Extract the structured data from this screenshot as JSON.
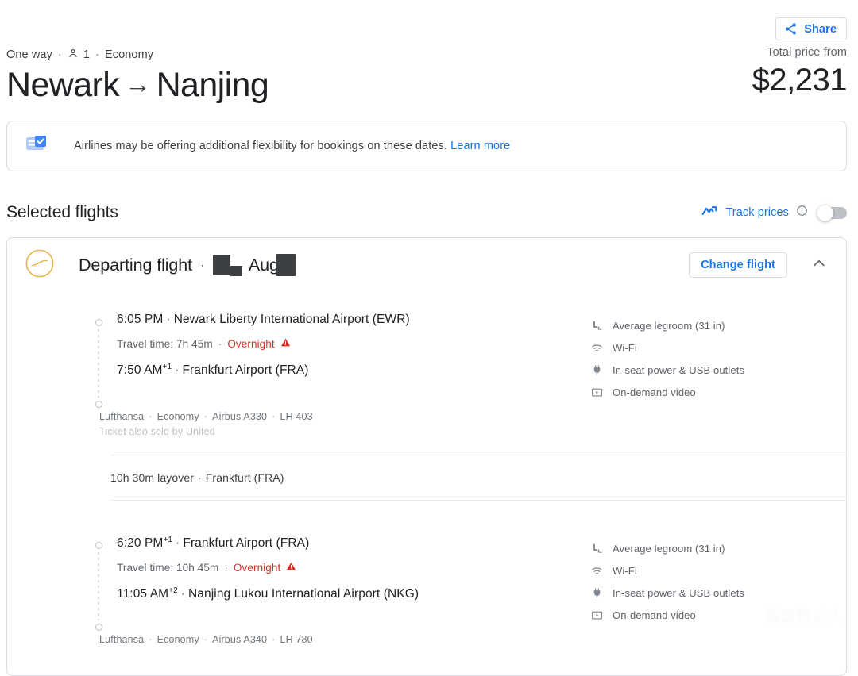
{
  "topbar": {
    "share_label": "Share",
    "share_icon": "share-icon"
  },
  "header": {
    "trip_type": "One way",
    "passengers": "1",
    "cabin": "Economy",
    "separator": "·",
    "origin": "Newark",
    "arrow": "→",
    "destination": "Nanjing",
    "price_label": "Total price from",
    "price_value": "$2,231"
  },
  "banner": {
    "icon": "ticket-check-icon",
    "text": "Airlines may be offering additional flexibility for bookings on these dates.",
    "link_label": "Learn more"
  },
  "selected": {
    "title": "Selected flights",
    "track_icon": "trending-line-icon",
    "track_label": "Track prices",
    "info_icon": "info-icon",
    "toggle_state": "off"
  },
  "flight_card": {
    "airline_logo": "lufthansa-crane-logo",
    "title": "Departing flight",
    "separator": "·",
    "date_month": "Aug",
    "date_redacted": true,
    "change_flight_label": "Change flight",
    "collapse_icon": "chevron-up-icon",
    "segments": [
      {
        "depart_time": "6:05 PM",
        "depart_day_offset": "",
        "depart_airport": "Newark Liberty International Airport (EWR)",
        "travel_time": "Travel time: 7h 45m",
        "overnight_label": "Overnight",
        "overnight_icon": "warning-triangle-icon",
        "arrive_time": "7:50 AM",
        "arrive_day_offset": "+1",
        "arrive_airport": "Frankfurt Airport (FRA)",
        "airline": "Lufthansa",
        "cabin": "Economy",
        "aircraft": "Airbus A330",
        "flight_number": "LH 403",
        "subnote": "Ticket also sold by United",
        "amenities": [
          {
            "icon": "legroom-icon",
            "label": "Average legroom (31 in)"
          },
          {
            "icon": "wifi-icon",
            "label": "Wi-Fi"
          },
          {
            "icon": "power-plug-icon",
            "label": "In-seat power & USB outlets"
          },
          {
            "icon": "video-screen-icon",
            "label": "On-demand video"
          }
        ]
      },
      {
        "depart_time": "6:20 PM",
        "depart_day_offset": "+1",
        "depart_airport": "Frankfurt Airport (FRA)",
        "travel_time": "Travel time: 10h 45m",
        "overnight_label": "Overnight",
        "overnight_icon": "warning-triangle-icon",
        "arrive_time": "11:05 AM",
        "arrive_day_offset": "+2",
        "arrive_airport": "Nanjing Lukou International Airport (NKG)",
        "airline": "Lufthansa",
        "cabin": "Economy",
        "aircraft": "Airbus A340",
        "flight_number": "LH 780",
        "subnote": "",
        "amenities": [
          {
            "icon": "legroom-icon",
            "label": "Average legroom (31 in)"
          },
          {
            "icon": "wifi-icon",
            "label": "Wi-Fi"
          },
          {
            "icon": "power-plug-icon",
            "label": "In-seat power & USB outlets"
          },
          {
            "icon": "video-screen-icon",
            "label": "On-demand video"
          }
        ]
      }
    ],
    "layover": {
      "duration": "10h 30m layover",
      "separator": "·",
      "location": "Frankfurt (FRA)"
    }
  },
  "watermark": {
    "icon": "wechat-icon",
    "text": "抛因特达人"
  },
  "colors": {
    "accent_blue": "#1a73e8",
    "warning_red": "#d93025",
    "lufthansa_gold": "#e8b54d",
    "text_primary": "#202124",
    "text_secondary": "#5f6368",
    "border": "#dadce0"
  }
}
